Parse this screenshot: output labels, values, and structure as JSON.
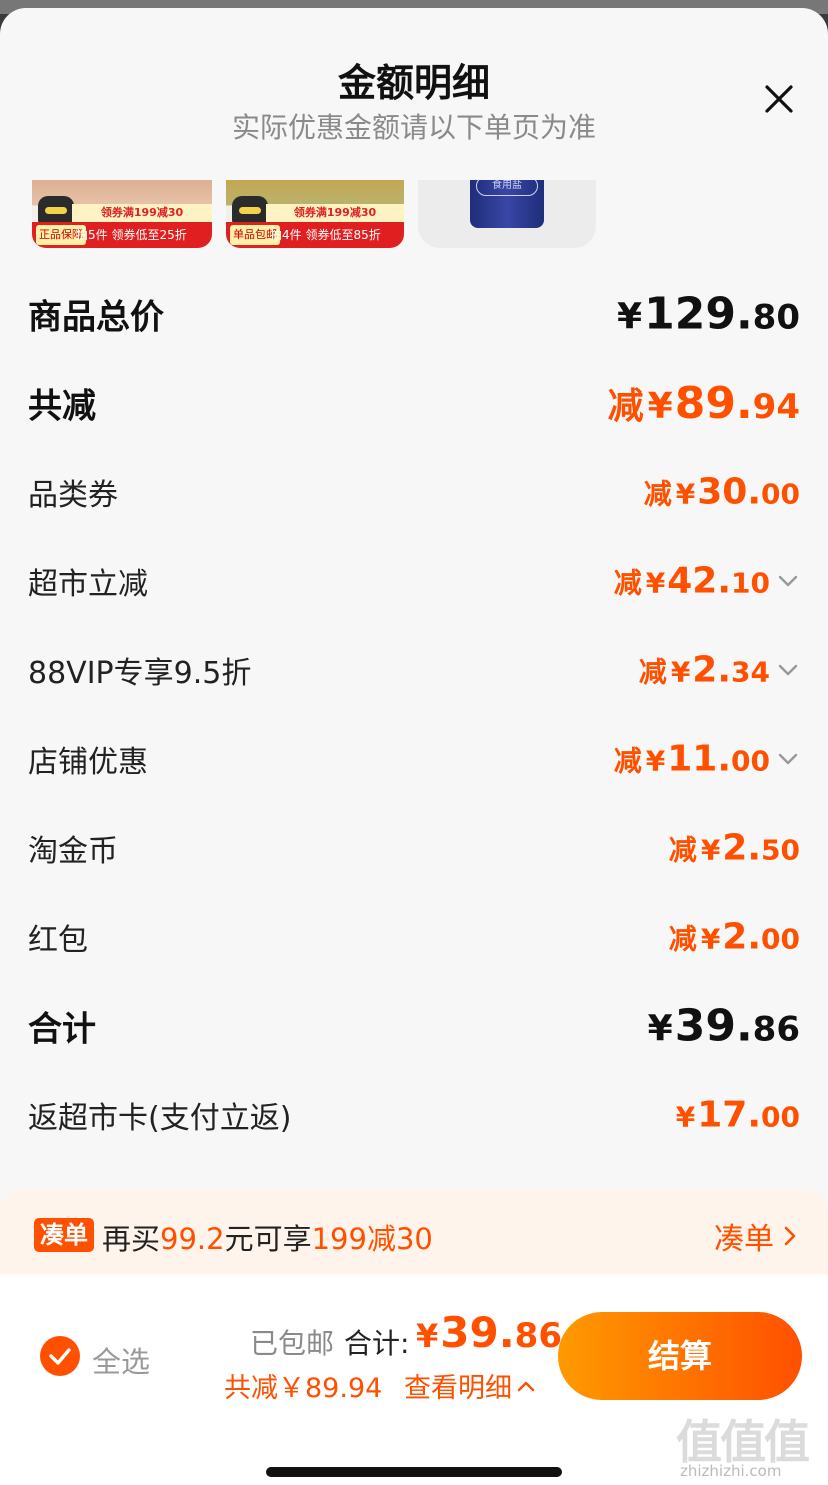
{
  "header": {
    "title": "金额明细",
    "subtitle": "实际优惠金额请以下单页为准"
  },
  "thumbnails": [
    {
      "tag": "正品保障",
      "promo_top": "领券满199减30",
      "promo": "拍5件 领券低至25折"
    },
    {
      "tag": "单品包邮",
      "promo_top": "领券满199减30",
      "promo": "拍4件 领券低至85折"
    },
    {
      "label": "食用盐"
    }
  ],
  "rows": [
    {
      "label": "商品总价",
      "prefix": "",
      "yen": "¥",
      "int": "129.",
      "dec": "80",
      "chevron": false
    },
    {
      "label": "共减",
      "prefix": "减",
      "yen": "¥",
      "int": "89.",
      "dec": "94",
      "chevron": false
    },
    {
      "label": "品类券",
      "prefix": "减",
      "yen": "¥",
      "int": "30.",
      "dec": "00",
      "chevron": false
    },
    {
      "label": "超市立减",
      "prefix": "减",
      "yen": "¥",
      "int": "42.",
      "dec": "10",
      "chevron": true
    },
    {
      "label": "88VIP专享9.5折",
      "prefix": "减",
      "yen": "¥",
      "int": "2.",
      "dec": "34",
      "chevron": true
    },
    {
      "label": "店铺优惠",
      "prefix": "减",
      "yen": "¥",
      "int": "11.",
      "dec": "00",
      "chevron": true
    },
    {
      "label": "淘金币",
      "prefix": "减",
      "yen": "¥",
      "int": "2.",
      "dec": "50",
      "chevron": false
    },
    {
      "label": "红包",
      "prefix": "减",
      "yen": "¥",
      "int": "2.",
      "dec": "00",
      "chevron": false
    },
    {
      "label": "合计",
      "prefix": "",
      "yen": "¥",
      "int": "39.",
      "dec": "86",
      "chevron": false
    },
    {
      "label": "返超市卡(支付立返)",
      "prefix": "",
      "yen": "¥",
      "int": "17.",
      "dec": "00",
      "chevron": false
    }
  ],
  "addon": {
    "tag": "凑单",
    "text_a": "再买",
    "amount": "99.2",
    "text_b": "元可享",
    "deal": "199减30",
    "link": "凑单"
  },
  "footer": {
    "select_all": "全选",
    "shipping": "已包邮",
    "total_label": "合计:",
    "total_yen": "¥",
    "total_int": "39.",
    "total_dec": "86",
    "saved": "共减￥89.94",
    "detail_link": "查看明细",
    "checkout": "结算"
  },
  "watermark": {
    "text": "值值值",
    "domain": "zhizhizhi.com"
  },
  "colors": {
    "accent": "#ff5000",
    "accent_light": "#ff9a00",
    "text_dark": "#111111",
    "text_muted": "#8a8a8a"
  }
}
